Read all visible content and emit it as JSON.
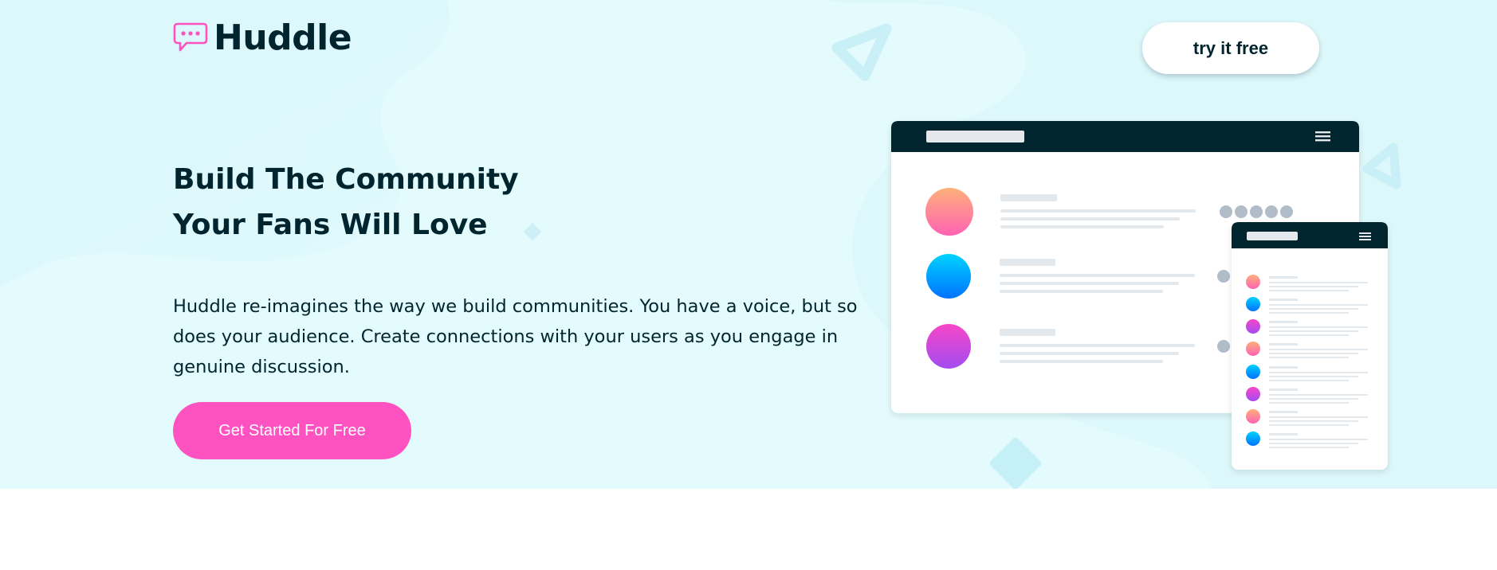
{
  "header": {
    "brand": "Huddle",
    "cta_label": "try it free"
  },
  "hero": {
    "headline_line1": "Build The Community",
    "headline_line2": "Your Fans Will Love",
    "description": "Huddle re-imagines the way we build communities. You have a voice, but so does your audience. Create connections with your users as you engage in genuine discussion.",
    "cta_label": "Get Started For Free"
  },
  "colors": {
    "brand_dark": "#00252e",
    "pink": "#ff52c1",
    "hero_bg": "#e3fbfc"
  },
  "icons": {
    "logo": "chat-bubble-icon",
    "menu": "hamburger-menu-icon"
  },
  "illustration": {
    "name": "app-mockup",
    "rows": [
      {
        "avatar_gradient": "orange-pink"
      },
      {
        "avatar_gradient": "cyan-blue"
      },
      {
        "avatar_gradient": "pink-purple"
      }
    ],
    "mobile_rows": [
      "orange-pink",
      "cyan-blue",
      "pink-purple",
      "orange-pink",
      "cyan-blue",
      "pink-purple",
      "orange-pink",
      "cyan-blue"
    ]
  }
}
